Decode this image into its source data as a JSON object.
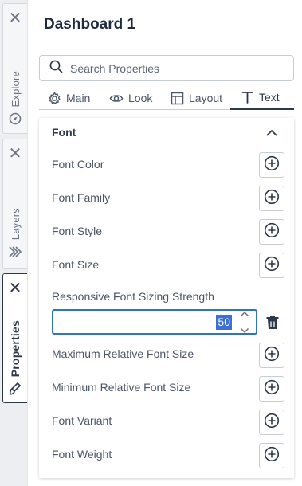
{
  "rail": {
    "tabs": [
      {
        "label": "Explore",
        "icon": "compass-icon",
        "active": false
      },
      {
        "label": "Layers",
        "icon": "layers-icon",
        "active": false
      },
      {
        "label": "Properties",
        "icon": "brush-icon",
        "active": true
      }
    ],
    "close_glyph": "✕"
  },
  "panel": {
    "title": "Dashboard 1",
    "search": {
      "placeholder": "Search Properties"
    },
    "tabs": [
      {
        "label": "Main",
        "icon": "gear-icon"
      },
      {
        "label": "Look",
        "icon": "eye-icon"
      },
      {
        "label": "Layout",
        "icon": "layout-icon"
      },
      {
        "label": "Text",
        "icon": "text-icon",
        "active": true
      }
    ],
    "section": {
      "title": "Font",
      "expanded": true,
      "properties": [
        {
          "label": "Font Color"
        },
        {
          "label": "Font Family"
        },
        {
          "label": "Font Style"
        },
        {
          "label": "Font Size"
        },
        {
          "label": "Responsive Font Sizing Strength",
          "value": "50"
        },
        {
          "label": "Maximum Relative Font Size"
        },
        {
          "label": "Minimum Relative Font Size"
        },
        {
          "label": "Font Variant"
        },
        {
          "label": "Font Weight"
        }
      ]
    }
  },
  "colors": {
    "accent": "#2f74c0",
    "selection": "#3d6fd6",
    "text": "#2d3848"
  }
}
